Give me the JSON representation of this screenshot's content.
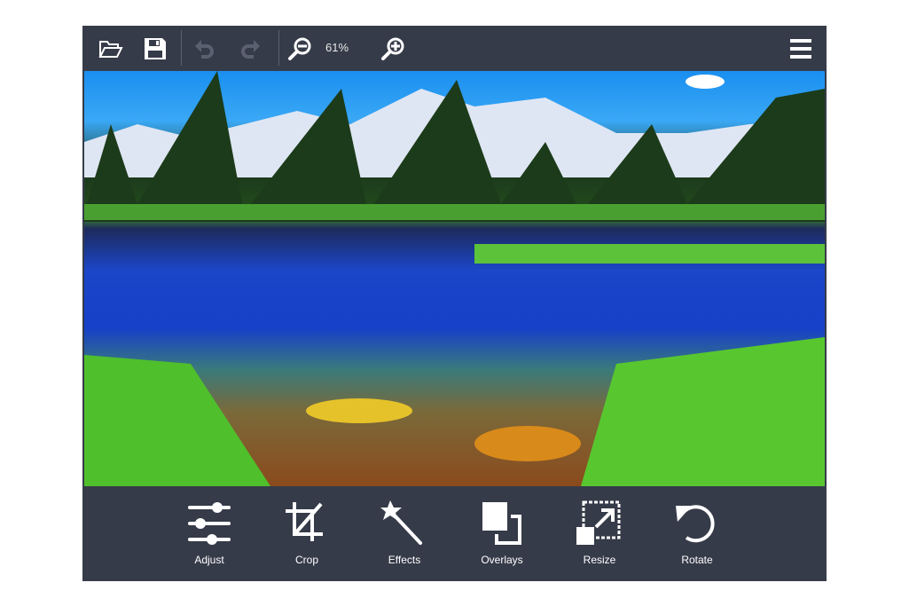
{
  "toolbar": {
    "zoom_level": "61%",
    "buttons": [
      {
        "name": "open",
        "icon": "folder-open-icon"
      },
      {
        "name": "save",
        "icon": "save-icon"
      },
      {
        "name": "undo",
        "icon": "undo-icon",
        "enabled": false
      },
      {
        "name": "redo",
        "icon": "redo-icon",
        "enabled": false
      },
      {
        "name": "zoom-out",
        "icon": "zoom-out-icon"
      },
      {
        "name": "zoom-in",
        "icon": "zoom-in-icon"
      },
      {
        "name": "menu",
        "icon": "hamburger-menu-icon"
      }
    ]
  },
  "tools": [
    {
      "label": "Adjust",
      "icon": "sliders-icon"
    },
    {
      "label": "Crop",
      "icon": "crop-icon"
    },
    {
      "label": "Effects",
      "icon": "magic-wand-icon"
    },
    {
      "label": "Overlays",
      "icon": "overlays-icon"
    },
    {
      "label": "Resize",
      "icon": "resize-icon"
    },
    {
      "label": "Rotate",
      "icon": "rotate-icon"
    }
  ],
  "colors": {
    "background": "#363b49",
    "icon": "#ffffff",
    "disabled_icon": "#5b6070"
  }
}
